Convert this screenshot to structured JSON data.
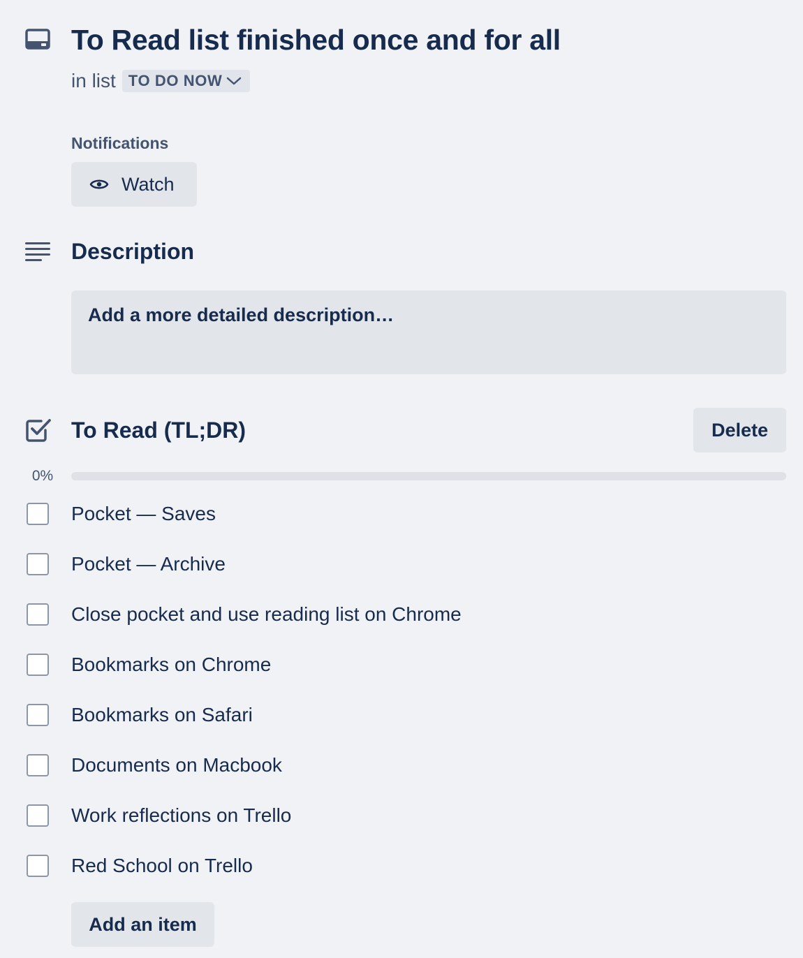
{
  "card": {
    "title": "To Read list finished once and for all",
    "in_list_prefix": "in list",
    "list_name": "TO DO NOW"
  },
  "notifications": {
    "label": "Notifications",
    "watch_label": "Watch"
  },
  "description": {
    "heading": "Description",
    "placeholder": "Add a more detailed description…"
  },
  "checklist": {
    "title": "To Read (TL;DR)",
    "delete_label": "Delete",
    "progress_text": "0%",
    "progress_fraction": 0,
    "items": [
      {
        "label": "Pocket — Saves",
        "checked": false
      },
      {
        "label": "Pocket — Archive",
        "checked": false
      },
      {
        "label": "Close pocket and use reading list on Chrome",
        "checked": false
      },
      {
        "label": "Bookmarks on Chrome",
        "checked": false
      },
      {
        "label": "Bookmarks on Safari",
        "checked": false
      },
      {
        "label": "Documents on Macbook",
        "checked": false
      },
      {
        "label": "Work reflections on Trello",
        "checked": false
      },
      {
        "label": "Red School on Trello",
        "checked": false
      }
    ],
    "add_item_label": "Add an item"
  },
  "icons": {
    "card": "card-icon",
    "list_dropdown": "chevron-down-icon",
    "watch": "eye-icon",
    "description": "description-lines-icon",
    "checklist": "checklist-icon"
  },
  "colors": {
    "background": "#f1f2f6",
    "text": "#172b4d",
    "subtle_text": "#44546f",
    "button_bg": "#e2e5ea",
    "progress_fill": "#579dff"
  }
}
